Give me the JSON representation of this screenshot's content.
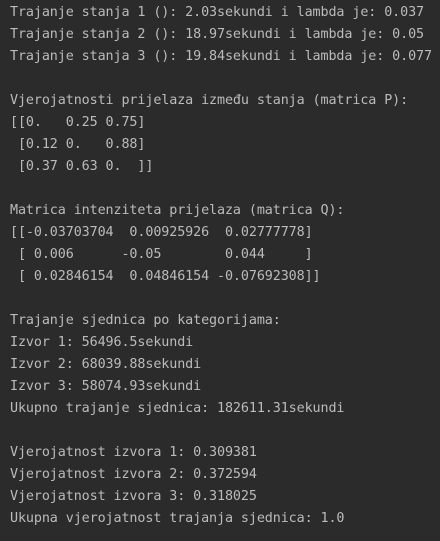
{
  "console": {
    "lines": [
      "Trajanje stanja 1 (): 2.03sekundi i lambda je: 0.037",
      "Trajanje stanja 2 (): 18.97sekundi i lambda je: 0.05",
      "Trajanje stanja 3 (): 19.84sekundi i lambda je: 0.077",
      "",
      "Vjerojatnosti prijelaza između stanja (matrica P):",
      "[[0.   0.25 0.75]",
      " [0.12 0.   0.88]",
      " [0.37 0.63 0.  ]]",
      "",
      "Matrica intenziteta prijelaza (matrica Q):",
      "[[-0.03703704  0.00925926  0.02777778]",
      " [ 0.006      -0.05        0.044     ]",
      " [ 0.02846154  0.04846154 -0.07692308]]",
      "",
      "Trajanje sjednica po kategorijama:",
      "Izvor 1: 56496.5sekundi",
      "Izvor 2: 68039.88sekundi",
      "Izvor 3: 58074.93sekundi",
      "Ukupno trajanje sjednica: 182611.31sekundi",
      "",
      "Vjerojatnost izvora 1: 0.309381",
      "Vjerojatnost izvora 2: 0.372594",
      "Vjerojatnost izvora 3: 0.318025",
      "Ukupna vjerojatnost trajanja sjednica: 1.0"
    ]
  }
}
